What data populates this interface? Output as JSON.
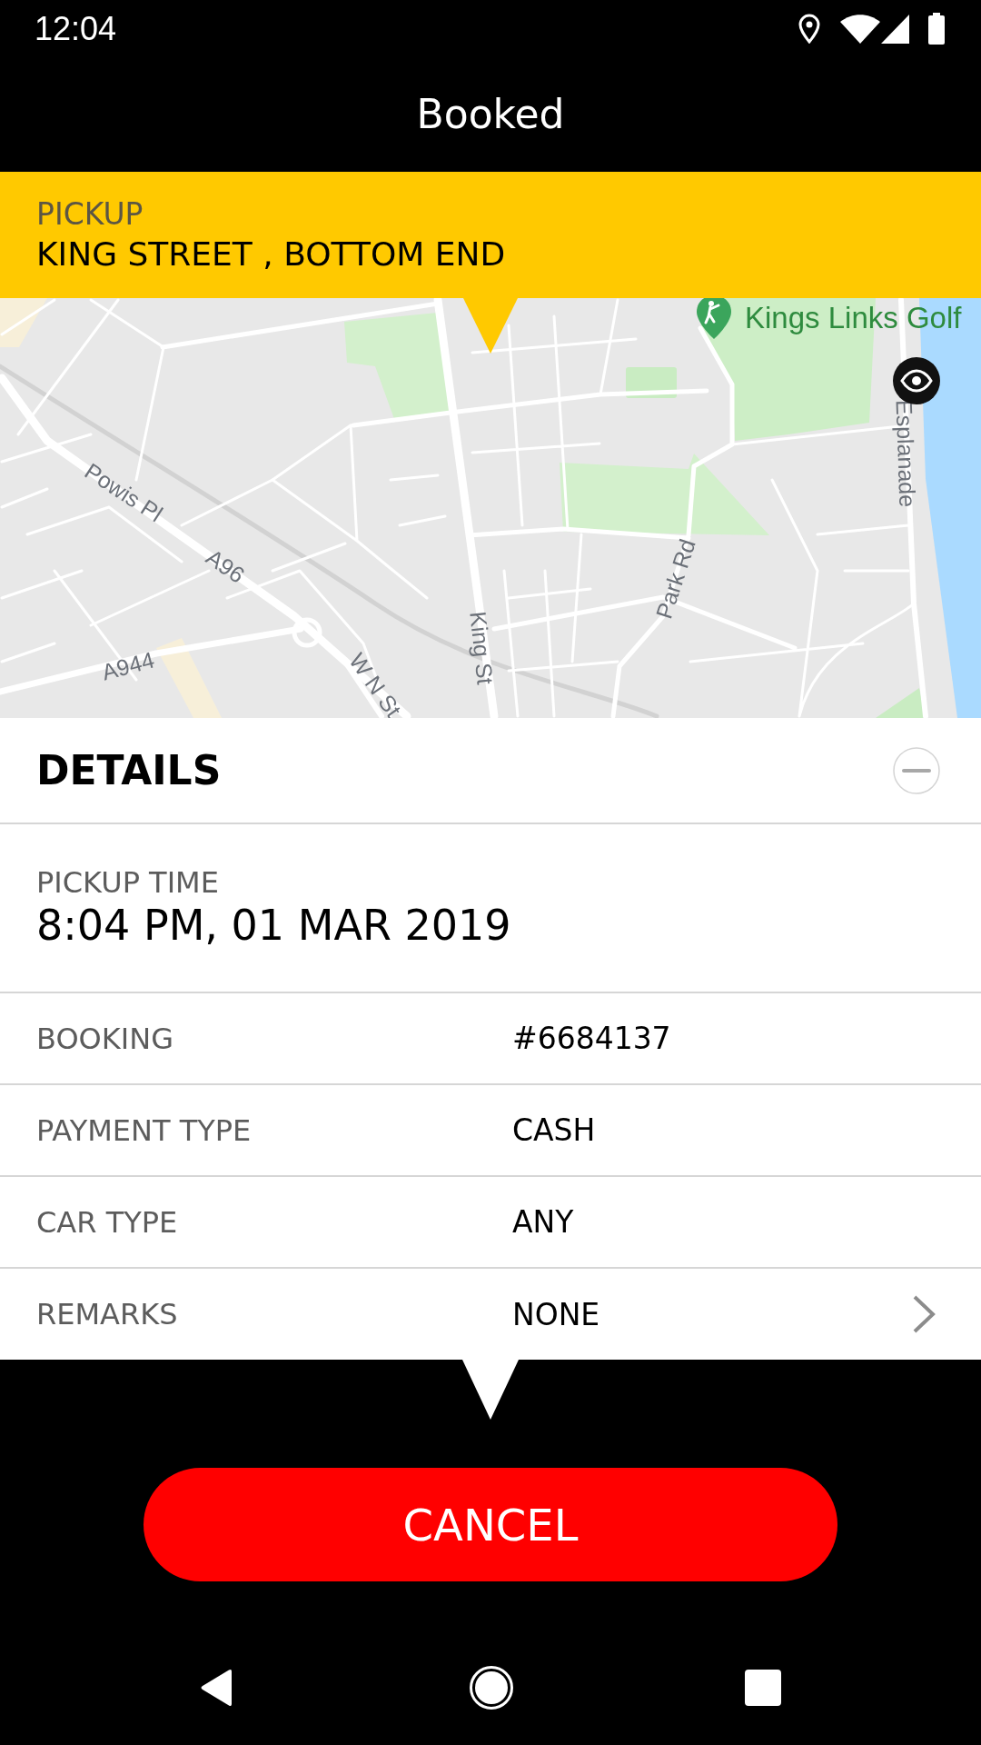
{
  "status_bar": {
    "time": "12:04"
  },
  "header": {
    "title": "Booked"
  },
  "pickup": {
    "label": "PICKUP",
    "address": "KING STREET , BOTTOM END"
  },
  "map": {
    "labels": [
      {
        "text": "Kings Links Golf",
        "kind": "poi"
      },
      {
        "text": "Esplanade",
        "kind": "street"
      },
      {
        "text": "Powis Pl",
        "kind": "street"
      },
      {
        "text": "A96",
        "kind": "street"
      },
      {
        "text": "Park Rd",
        "kind": "street"
      },
      {
        "text": "King St",
        "kind": "street"
      },
      {
        "text": "A944",
        "kind": "street"
      },
      {
        "text": "W N St",
        "kind": "street"
      }
    ]
  },
  "details": {
    "title": "DETAILS",
    "expanded": true,
    "pickup_time": {
      "label": "PICKUP TIME",
      "value": "8:04 PM, 01 MAR 2019"
    },
    "rows": [
      {
        "label": "BOOKING",
        "value": "#6684137",
        "chevron": false
      },
      {
        "label": "PAYMENT TYPE",
        "value": "CASH",
        "chevron": false
      },
      {
        "label": "CAR TYPE",
        "value": "ANY",
        "chevron": false
      },
      {
        "label": "REMARKS",
        "value": "NONE",
        "chevron": true
      }
    ]
  },
  "cancel_button": {
    "label": "CANCEL"
  }
}
